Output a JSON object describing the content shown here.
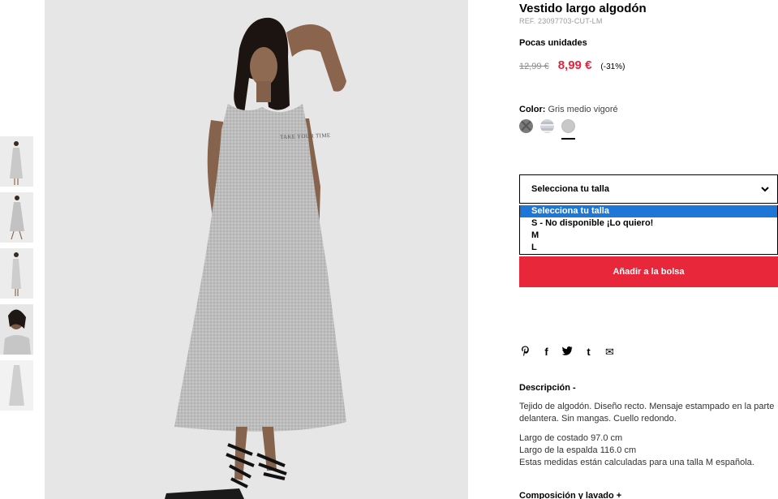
{
  "product": {
    "title": "Vestido largo algodón",
    "reference": "REF. 23097703-CUT-LM",
    "stock_notice": "Pocas unidades",
    "old_price": "12,99 €",
    "new_price": "8,99 €",
    "discount": "(-31%)",
    "print_text": "TAKE YOUR TIME"
  },
  "color": {
    "label": "Color:",
    "value": "Gris medio vigoré",
    "swatches": [
      "dark-grey-crossed",
      "striped",
      "grey-melange"
    ],
    "selected_index": 2
  },
  "size": {
    "select_label": "Selecciona tu talla",
    "options": [
      "Selecciona tu talla",
      "S - No disponible ¡Lo quiero!",
      "M",
      "L"
    ],
    "highlighted_index": 0
  },
  "actions": {
    "add_to_bag": "Añadir a la bolsa"
  },
  "share": {
    "icons": [
      "pinterest-icon",
      "facebook-icon",
      "twitter-icon",
      "tumblr-icon",
      "email-icon"
    ],
    "glyphs": [
      "𝓅",
      "f",
      "t",
      "t",
      "✉"
    ]
  },
  "description": {
    "title": "Descripción -",
    "paragraph": "Tejido de algodón. Diseño recto. Mensaje estampado en la parte delantera. Sin mangas. Cuello redondo.",
    "line1": "Largo de costado 97.0 cm",
    "line2": "Largo de la espalda 116.0 cm",
    "line3": "Estas medidas están calculadas para una talla M española."
  },
  "composition": {
    "title": "Composición y lavado +"
  },
  "colors": {
    "accent_red": "#e9273a",
    "price_red": "#e0263c",
    "highlight_blue": "#1e76d6"
  }
}
